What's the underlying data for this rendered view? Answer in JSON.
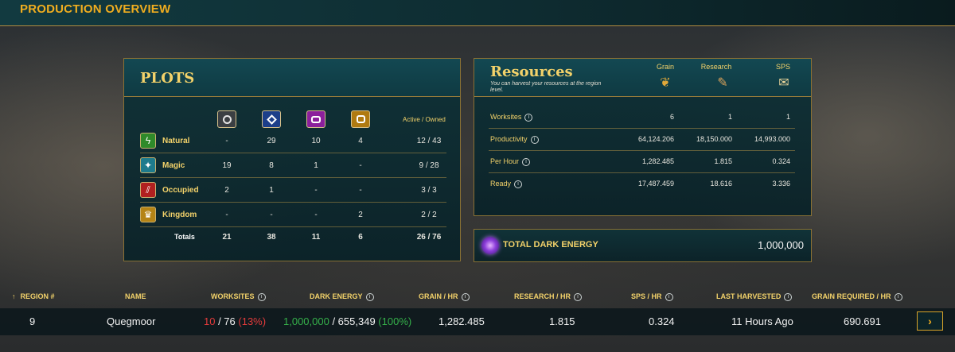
{
  "header": {
    "title": "PRODUCTION OVERVIEW"
  },
  "plots": {
    "title": "PLOTS",
    "active_owned_header": "Active / Owned",
    "rarity_icons": [
      "common-rarity-icon",
      "rare-rarity-icon",
      "epic-rarity-icon",
      "legendary-rarity-icon"
    ],
    "rows": [
      {
        "icon": "natural-icon",
        "label": "Natural",
        "values": [
          "-",
          "29",
          "10",
          "4"
        ],
        "active_owned": "12 / 43"
      },
      {
        "icon": "magic-icon",
        "label": "Magic",
        "values": [
          "19",
          "8",
          "1",
          "-"
        ],
        "active_owned": "9 / 28"
      },
      {
        "icon": "occupied-icon",
        "label": "Occupied",
        "values": [
          "2",
          "1",
          "-",
          "-"
        ],
        "active_owned": "3 / 3"
      },
      {
        "icon": "kingdom-icon",
        "label": "Kingdom",
        "values": [
          "-",
          "-",
          "-",
          "2"
        ],
        "active_owned": "2 / 2"
      }
    ],
    "totals": {
      "label": "Totals",
      "values": [
        "21",
        "38",
        "11",
        "6"
      ],
      "active_owned": "26 / 76"
    }
  },
  "resources": {
    "title": "Resources",
    "subtitle": "You can harvest your resources at the region level.",
    "columns": [
      "Grain",
      "Research",
      "SPS"
    ],
    "rows": [
      {
        "label": "Worksites",
        "values": [
          "6",
          "1",
          "1"
        ]
      },
      {
        "label": "Productivity",
        "values": [
          "64,124.206",
          "18,150.000",
          "14,993.000"
        ]
      },
      {
        "label": "Per Hour",
        "values": [
          "1,282.485",
          "1.815",
          "0.324"
        ]
      },
      {
        "label": "Ready",
        "values": [
          "17,487.459",
          "18.616",
          "3.336"
        ]
      }
    ]
  },
  "dark_energy": {
    "label": "TOTAL DARK ENERGY",
    "value": "1,000,000"
  },
  "region_table": {
    "sort_arrow": "↑",
    "headers": [
      "REGION #",
      "NAME",
      "WORKSITES",
      "DARK ENERGY",
      "GRAIN / HR",
      "RESEARCH / HR",
      "SPS / HR",
      "LAST HARVESTED",
      "GRAIN REQUIRED / HR"
    ],
    "row": {
      "region": "9",
      "name": "Quegmoor",
      "worksites_active": "10",
      "worksites_rest": " / 76 ",
      "worksites_pct": "(13%)",
      "de_current": "1,000,000",
      "de_rest": " / 655,349 ",
      "de_pct": "(100%)",
      "grain_hr": "1,282.485",
      "research_hr": "1.815",
      "sps_hr": "0.324",
      "last_harvested": "11 Hours Ago",
      "grain_required": "690.691"
    },
    "action_glyph": "›"
  },
  "colors": {
    "accent": "#f0ad1f",
    "label_gold": "#f3d26a",
    "red": "#e33b3b",
    "green": "#35b04a"
  }
}
